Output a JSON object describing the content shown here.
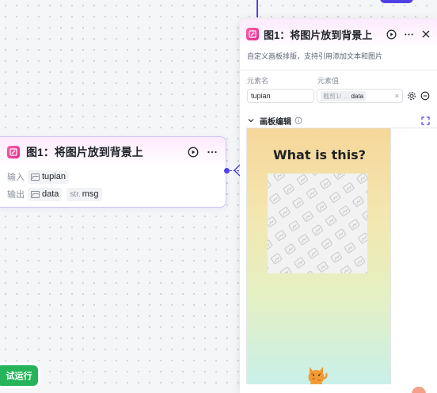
{
  "node": {
    "title": "图1：将图片放到背景上",
    "input_label": "输入",
    "input_tag": "tupian",
    "output_label": "输出",
    "output_tag": "data",
    "output_tag2_type": "str.",
    "output_tag2": "msg"
  },
  "panel": {
    "title": "图1：将图片放到背景上",
    "description": "自定义画板排版，支持引用添加文本和图片",
    "field_name_header": "元素名",
    "field_value_header": "元素值",
    "field_name_value": "tupian",
    "field_value_prefix": "截剪1/",
    "field_value_middle": "...",
    "field_value_ref": "data",
    "section_title": "画板编辑",
    "canvas_text": "What is this?"
  },
  "run_button": "试运行",
  "colors": {
    "accent": "#4e40e5",
    "app_icon": "#e02d8f",
    "run_button": "#25b45a"
  },
  "icons": [
    "play-icon",
    "more-icon",
    "close-icon",
    "settings-icon",
    "remove-icon",
    "chevron-down-icon",
    "info-icon",
    "expand-icon",
    "image-icon",
    "cat-sticker"
  ]
}
